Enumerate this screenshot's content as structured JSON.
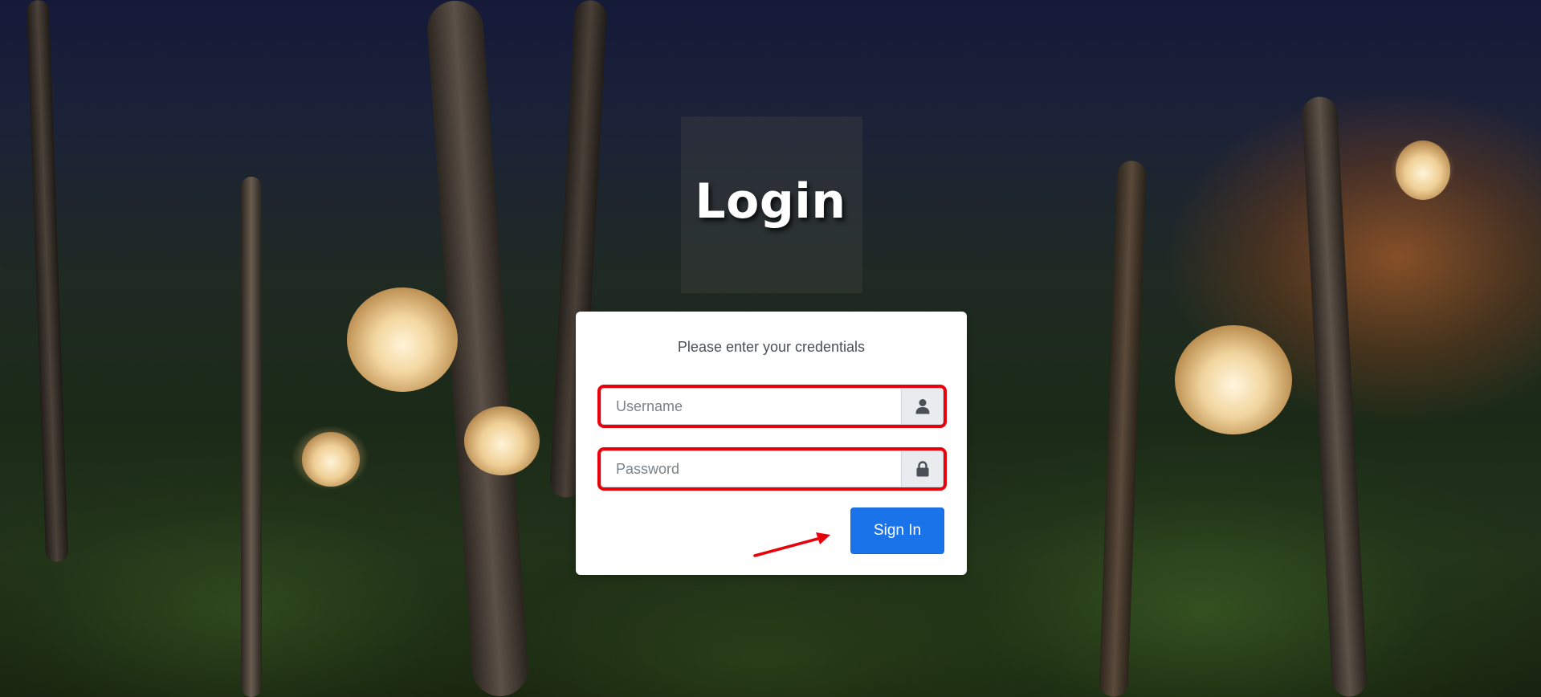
{
  "page": {
    "title": "Login"
  },
  "login_form": {
    "subtitle": "Please enter your credentials",
    "username": {
      "placeholder": "Username",
      "value": "",
      "icon": "user-icon"
    },
    "password": {
      "placeholder": "Password",
      "value": "",
      "icon": "lock-icon"
    },
    "submit_label": "Sign In"
  },
  "colors": {
    "primary_button": "#1a73e8",
    "highlight_outline": "#e8000b",
    "card_background": "#ffffff",
    "title_text": "#ffffff"
  }
}
